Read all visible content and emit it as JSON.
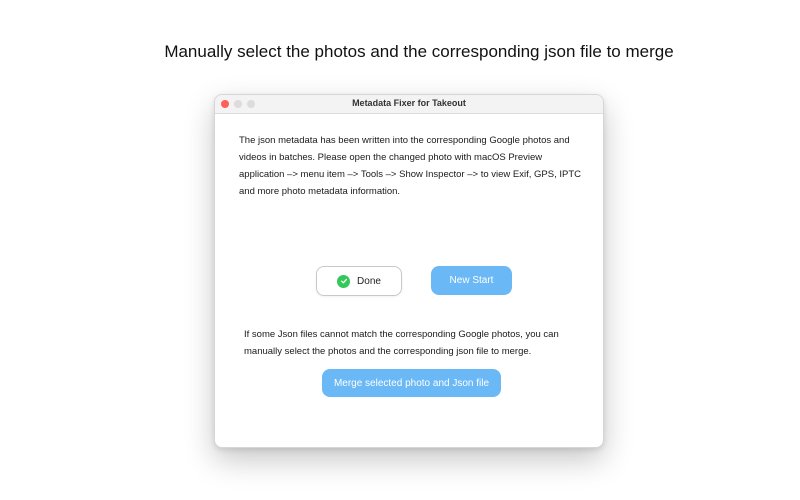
{
  "headline": "Manually select the photos and the corresponding json file to merge",
  "window": {
    "title": "Metadata Fixer for Takeout",
    "traffic_lights": {
      "close_color": "#ff5f57",
      "minimize_color": "#dcdcdc",
      "maximize_color": "#dcdcdc"
    }
  },
  "content": {
    "description": "The json metadata has been written into the corresponding Google photos and videos in batches. Please open the changed photo with macOS Preview application –> menu item  –> Tools –> Show Inspector –> to view Exif, GPS, IPTC and more photo metadata information.",
    "done_button": {
      "label": "Done",
      "icon": "check-circle-icon",
      "icon_color": "#34c759"
    },
    "new_start_button": {
      "label": "New Start",
      "color": "#6ab8f5"
    },
    "merge_note": "If some Json files cannot match the corresponding Google photos, you can manually select the photos and the corresponding json file to merge.",
    "merge_button": {
      "label": "Merge selected photo and Json file",
      "color": "#6ab8f5"
    }
  }
}
